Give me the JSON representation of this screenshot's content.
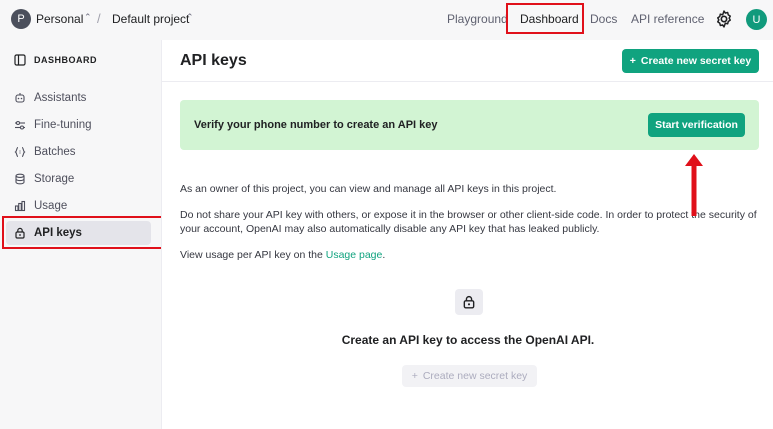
{
  "topbar": {
    "org_initial": "P",
    "org_name": "Personal",
    "separator": "/",
    "project_name": "Default project",
    "nav": [
      "Playground",
      "Dashboard",
      "Docs",
      "API reference"
    ],
    "active_nav": "Dashboard",
    "user_initial": "U",
    "settings_icon": "gear-icon"
  },
  "sidebar": {
    "heading": "DASHBOARD",
    "items": [
      {
        "label": "Assistants",
        "icon": "robot-icon"
      },
      {
        "label": "Fine-tuning",
        "icon": "sliders-icon"
      },
      {
        "label": "Batches",
        "icon": "braces-icon"
      },
      {
        "label": "Storage",
        "icon": "database-icon"
      },
      {
        "label": "Usage",
        "icon": "bar-chart-icon"
      },
      {
        "label": "API keys",
        "icon": "lock-icon"
      }
    ],
    "active_item": "API keys"
  },
  "main": {
    "title": "API keys",
    "create_button": "Create new secret key",
    "verify_banner": {
      "text": "Verify your phone number to create an API key",
      "button": "Start verification"
    },
    "paragraphs": {
      "p1": "As an owner of this project, you can view and manage all API keys in this project.",
      "p2": "Do not share your API key with others, or expose it in the browser or other client-side code. In order to protect the security of your account, OpenAI may also automatically disable any API key that has leaked publicly.",
      "p3_prefix": "View usage per API key on the ",
      "p3_link": "Usage page",
      "p3_suffix": "."
    },
    "empty_state": {
      "title": "Create an API key to access the OpenAI API.",
      "button": "Create new secret key"
    }
  },
  "colors": {
    "accent": "#10a37f",
    "banner": "#d2f4d3",
    "highlight": "#e0101a"
  }
}
